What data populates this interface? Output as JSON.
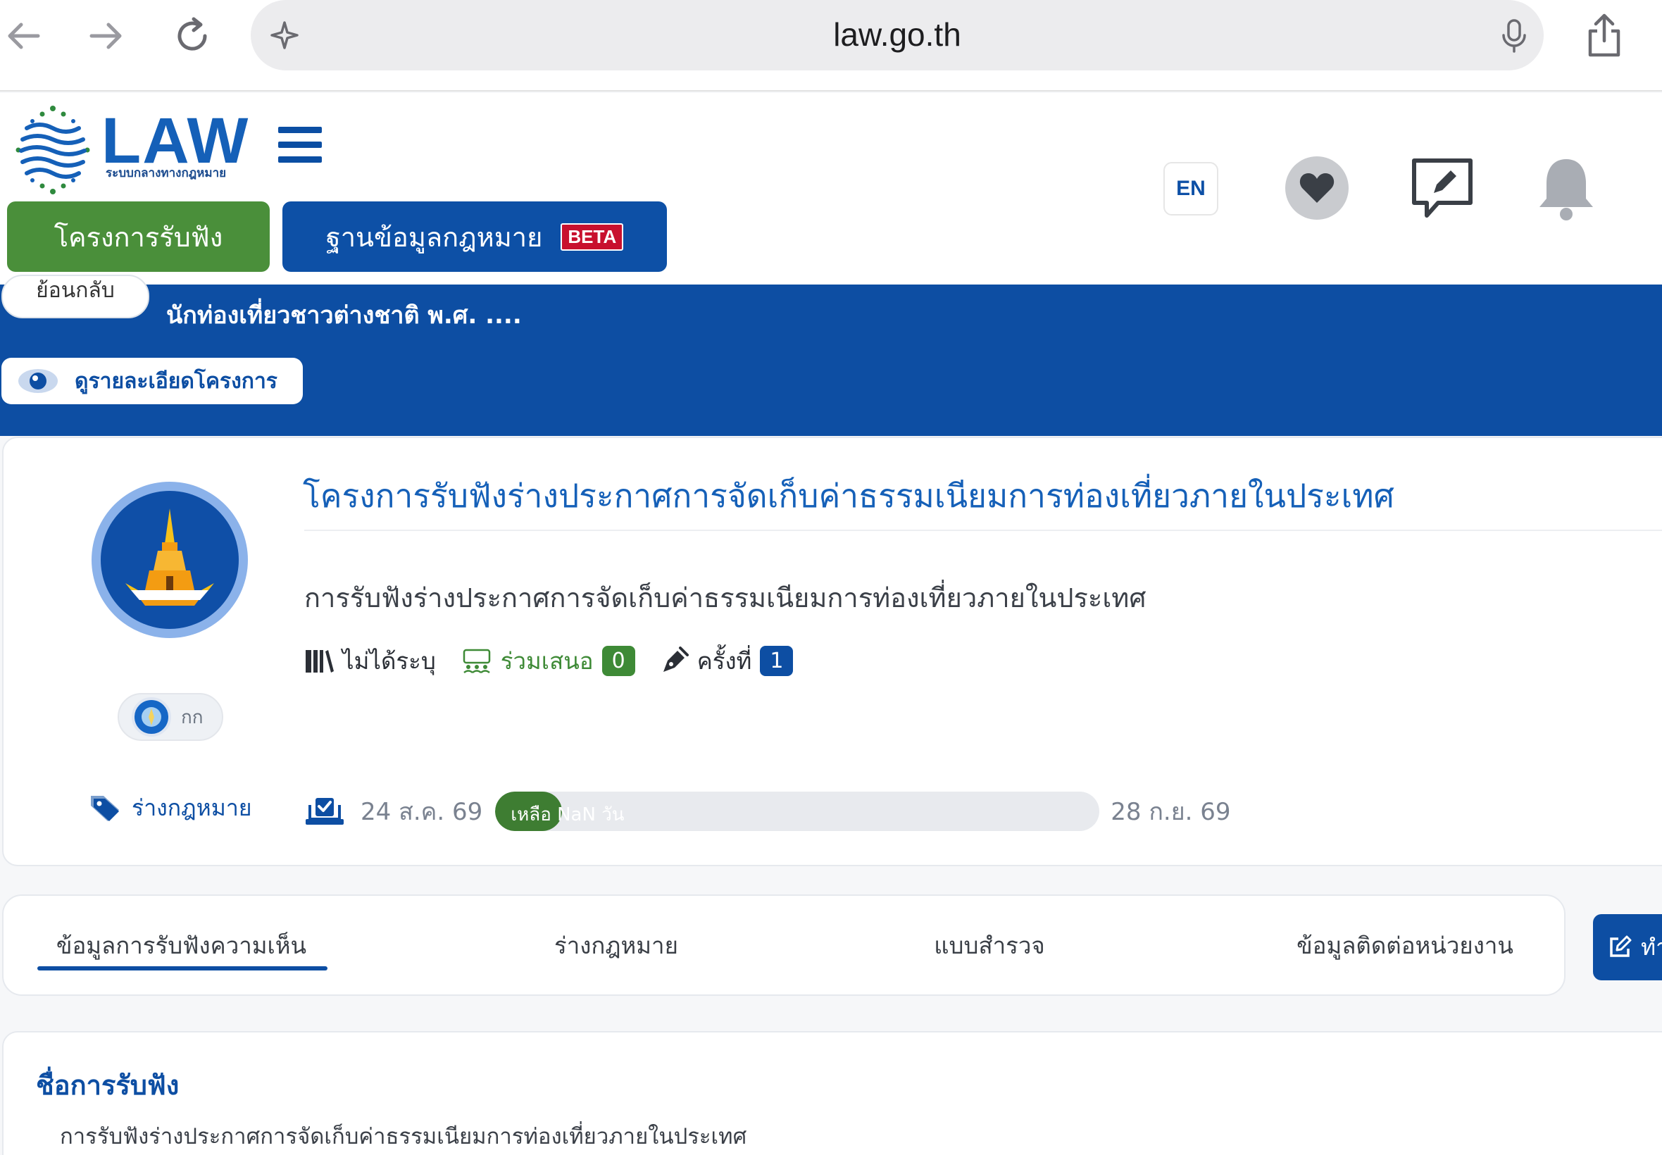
{
  "browser": {
    "url": "law.go.th"
  },
  "header": {
    "logo_text": "LAW",
    "logo_subtitle": "ระบบกลางทางกฎหมาย",
    "nav_projects": "โครงการรับฟัง",
    "nav_database": "ฐานข้อมูลกฎหมาย",
    "beta": "BETA",
    "lang": "EN"
  },
  "banner": {
    "back_label": "ย้อนกลับ",
    "title_fragment": "นักท่องเที่ยวชาวต่างชาติ พ.ศ. ....",
    "detail_button": "ดูรายละเอียดโครงการ"
  },
  "project": {
    "title": "โครงการรับฟังร่างประกาศการจัดเก็บค่าธรรมเนียมการท่องเที่ยวภายในประเทศ",
    "description": "การรับฟังร่างประกาศการจัดเก็บค่าธรรมเนียมการท่องเที่ยวภายในประเทศ",
    "category": "ไม่ได้ระบุ",
    "participate_label": "ร่วมเสนอ",
    "participate_count": "0",
    "round_label": "ครั้งที่",
    "round_number": "1",
    "agency_name": "กก",
    "tag": "ร่างกฎหมาย",
    "start_date": "24 ส.ค. 69",
    "end_date": "28 ก.ย. 69",
    "remaining_text": "เหลือ NaN วัน",
    "remaining_fraction": 0.11
  },
  "tabs": [
    {
      "label": "ข้อมูลการรับฟังความเห็น",
      "active": true
    },
    {
      "label": "ร่างกฎหมาย",
      "active": false
    },
    {
      "label": "แบบสำรวจ",
      "active": false
    },
    {
      "label": "ข้อมูลติดต่อหน่วยงาน",
      "active": false
    }
  ],
  "action_button": "ทำ",
  "section": {
    "title": "ชื่อการรับฟัง",
    "value": "การรับฟังร่างประกาศการจัดเก็บค่าธรรมเนียมการท่องเที่ยวภายในประเทศ"
  },
  "colors": {
    "primary_blue": "#0d4ea3",
    "green": "#4a8f3a",
    "beta_red": "#c8102e"
  }
}
